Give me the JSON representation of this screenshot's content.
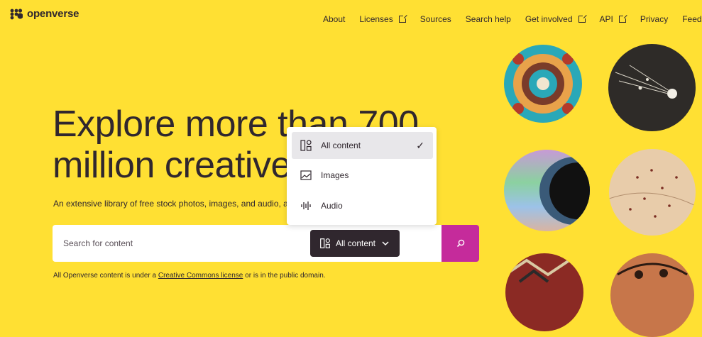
{
  "header": {
    "logo_text": "openverse",
    "nav": [
      {
        "label": "About",
        "external": false
      },
      {
        "label": "Licenses",
        "external": true
      },
      {
        "label": "Sources",
        "external": false
      },
      {
        "label": "Search help",
        "external": false
      },
      {
        "label": "Get involved",
        "external": true
      },
      {
        "label": "API",
        "external": true
      },
      {
        "label": "Privacy",
        "external": false
      },
      {
        "label": "Feedback",
        "external": false
      }
    ]
  },
  "hero": {
    "headline": "Explore more than 700 million creative works",
    "subtitle": "An extensive library of free stock photos, images, and audio, available for free use."
  },
  "search": {
    "placeholder": "Search for content",
    "content_type_label": "All content",
    "submit_icon": "search-icon"
  },
  "dropdown": {
    "items": [
      {
        "label": "All content",
        "icon": "all-content-icon",
        "selected": true
      },
      {
        "label": "Images",
        "icon": "image-icon",
        "selected": false
      },
      {
        "label": "Audio",
        "icon": "audio-icon",
        "selected": false
      }
    ]
  },
  "footnote": {
    "prefix": "All Openverse content is under a ",
    "link": "Creative Commons license",
    "suffix": " or is in the public domain."
  },
  "colors": {
    "background": "#ffe033",
    "text": "#30272e",
    "search_button": "#c52b9b",
    "content_button": "#30272e"
  }
}
